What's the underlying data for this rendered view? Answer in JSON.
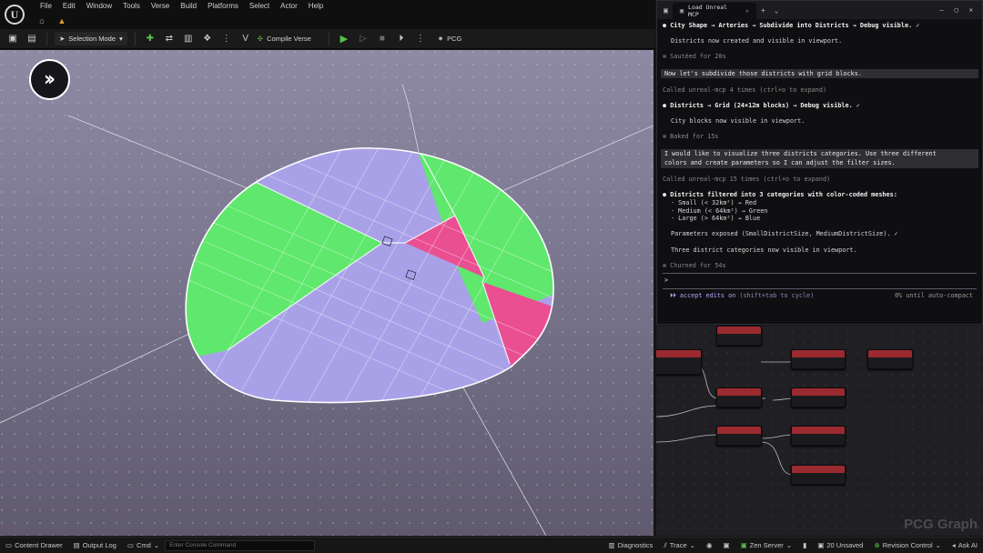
{
  "menubar": {
    "items": [
      "File",
      "Edit",
      "Window",
      "Tools",
      "Verse",
      "Build",
      "Platforms",
      "Select",
      "Actor",
      "Help"
    ]
  },
  "toolbar": {
    "mode_label": "Selection Mode",
    "compile_label": "Compile Verse",
    "pcg_label": "PCG"
  },
  "terminal": {
    "tab_title": "Load Unreal MCP",
    "lines": [
      {
        "type": "bullet",
        "text": "City Shape → Arteries → Subdivide into Districts → Debug visible. ✓"
      },
      {
        "type": "gap"
      },
      {
        "type": "text",
        "text": "Districts now created and visible in viewport."
      },
      {
        "type": "gap"
      },
      {
        "type": "dim",
        "text": "✻ Sautéed for 20s"
      },
      {
        "type": "gap"
      },
      {
        "type": "user",
        "text": "Now let's subdivide those districts with grid blocks."
      },
      {
        "type": "gap"
      },
      {
        "type": "dim",
        "text": "Called unreal-mcp 4 times (ctrl+o to expand)"
      },
      {
        "type": "gap"
      },
      {
        "type": "bullet",
        "text": "Districts → Grid (24×12m blocks) → Debug visible. ✓"
      },
      {
        "type": "gap"
      },
      {
        "type": "text",
        "text": "City blocks now visible in viewport."
      },
      {
        "type": "gap"
      },
      {
        "type": "dim",
        "text": "✻ Baked for 15s"
      },
      {
        "type": "gap"
      },
      {
        "type": "user",
        "text": "I would like to visualize three districts categories. Use three different"
      },
      {
        "type": "user",
        "text": "colors and create parameters so I can adjust the filter sizes."
      },
      {
        "type": "gap"
      },
      {
        "type": "dim",
        "text": "Called unreal-mcp 15 times (ctrl+o to expand)"
      },
      {
        "type": "gap"
      },
      {
        "type": "bullet",
        "text": "Districts filtered into 3 categories with color-coded meshes:"
      },
      {
        "type": "text",
        "text": "- Small (< 32km²) → Red"
      },
      {
        "type": "text",
        "text": "- Medium (< 64km²) → Green"
      },
      {
        "type": "text",
        "text": "- Large (> 64km²) → Blue"
      },
      {
        "type": "gap"
      },
      {
        "type": "text",
        "text": "Parameters exposed (SmallDistrictSize, MediumDistrictSize). ✓"
      },
      {
        "type": "gap"
      },
      {
        "type": "text",
        "text": "Three district categories now visible in viewport."
      },
      {
        "type": "gap"
      },
      {
        "type": "dim",
        "text": "✻ Churned for 54s"
      }
    ],
    "prompt": ">",
    "status_left": "accept edits on",
    "status_hint": "(shift+tab to cycle)",
    "status_right": "0% until auto-compact"
  },
  "graph": {
    "watermark": "PCG Graph"
  },
  "statusbar": {
    "content_drawer": "Content Drawer",
    "output_log": "Output Log",
    "cmd": "Cmd",
    "console_placeholder": "Enter Console Command",
    "diagnostics": "Diagnostics",
    "trace": "Trace",
    "zen_server": "Zen Server",
    "unsaved": "20 Unsaved",
    "revision_control": "Revision Control",
    "ask_ai": "Ask AI"
  },
  "colors": {
    "district_large": "#a9a1e8",
    "district_medium": "#5fe86d",
    "district_small": "#ea4f92",
    "node_header": "#9a2a2f"
  },
  "icons": [
    "unreal-logo-icon",
    "home-icon",
    "save-icon",
    "play-icon",
    "forward-icon",
    "pause-icon",
    "stop-icon",
    "chevron-down-icon",
    "gear-icon"
  ]
}
